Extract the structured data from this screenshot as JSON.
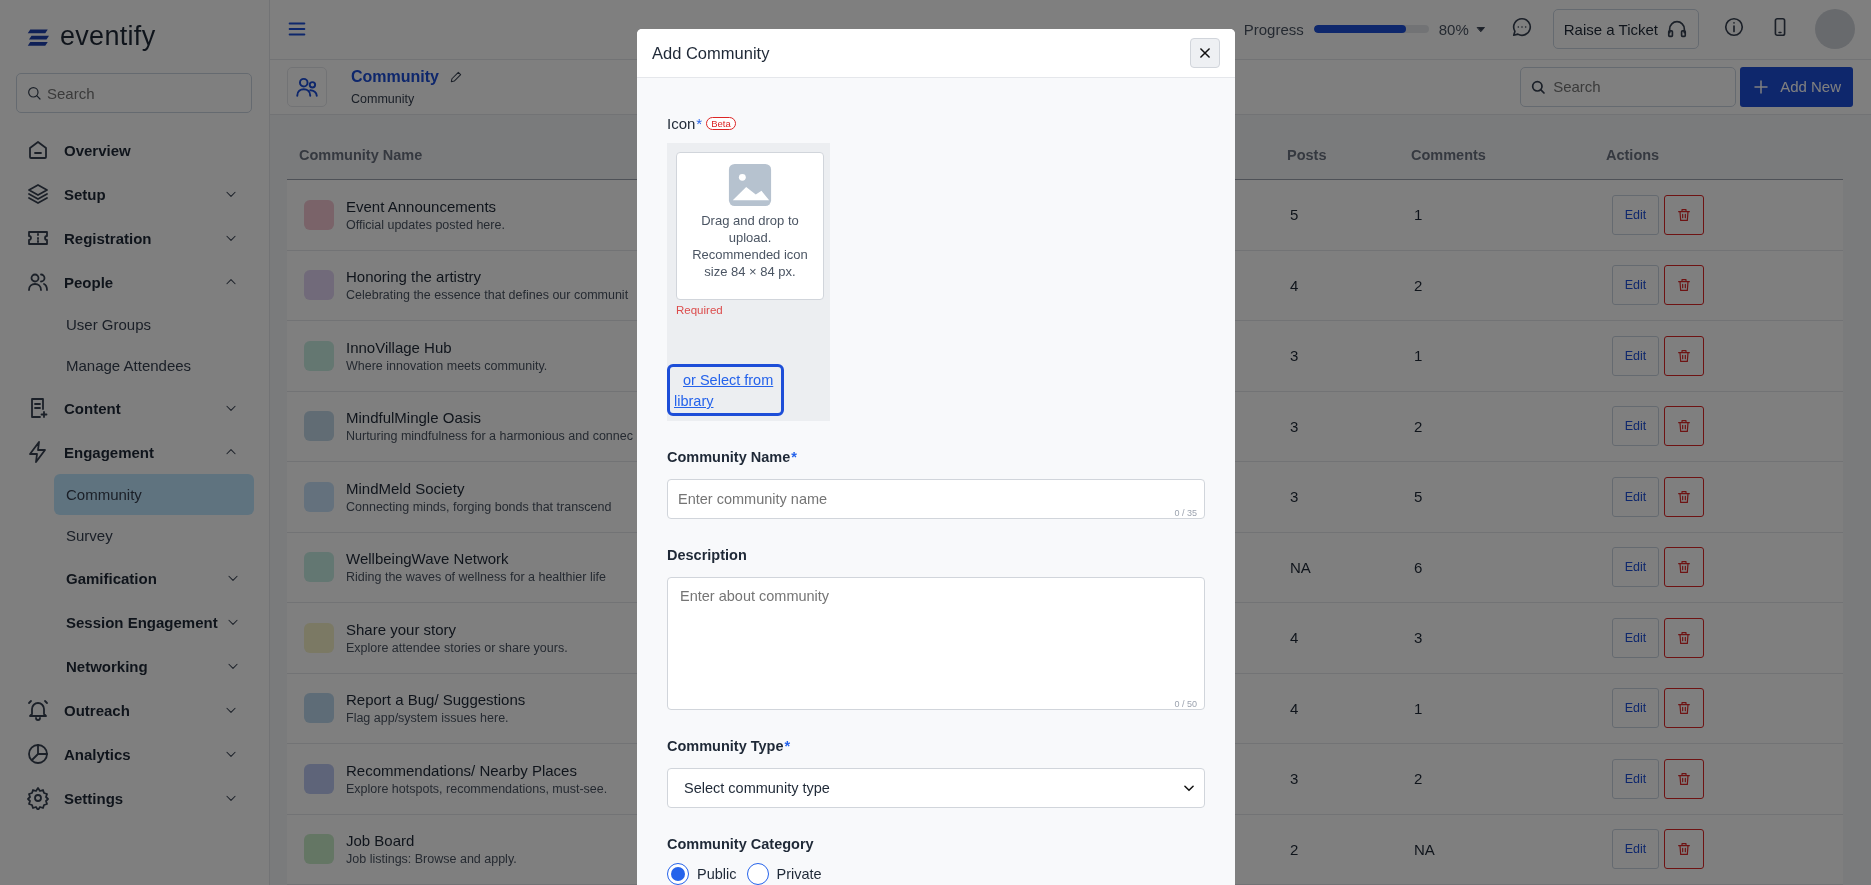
{
  "sidebar": {
    "logo": "eventify",
    "search": {
      "placeholder": "Search"
    },
    "items": [
      {
        "kind": "link",
        "label": "Overview"
      },
      {
        "kind": "group",
        "label": "Setup",
        "expanded": false
      },
      {
        "kind": "group",
        "label": "Registration",
        "expanded": false
      },
      {
        "kind": "group",
        "label": "People",
        "expanded": true,
        "children": [
          {
            "kind": "link",
            "label": "User Groups",
            "selected": false
          },
          {
            "kind": "link",
            "label": "Manage Attendees",
            "selected": false
          }
        ]
      },
      {
        "kind": "group",
        "label": "Content",
        "expanded": false
      },
      {
        "kind": "group",
        "label": "Engagement",
        "expanded": true,
        "children": [
          {
            "kind": "link",
            "label": "Community",
            "selected": true
          },
          {
            "kind": "link",
            "label": "Survey",
            "selected": false
          },
          {
            "kind": "group",
            "label": "Gamification",
            "expanded": false
          },
          {
            "kind": "group",
            "label": "Session Engagement",
            "expanded": false
          },
          {
            "kind": "group",
            "label": "Networking",
            "expanded": false
          }
        ]
      },
      {
        "kind": "group",
        "label": "Outreach",
        "expanded": false
      },
      {
        "kind": "group",
        "label": "Analytics",
        "expanded": false
      },
      {
        "kind": "group",
        "label": "Settings",
        "expanded": false
      }
    ]
  },
  "header": {
    "progress": {
      "label": "Progress",
      "level": 0.8,
      "reading": "80%"
    },
    "ticket_button": "Raise a Ticket"
  },
  "page_header": {
    "title": "Community",
    "subtitle": "Community",
    "search": {
      "placeholder": "Search"
    },
    "add_button": "Add New"
  },
  "table": {
    "columns": [
      "Community Name",
      "Posts",
      "Comments",
      "Actions"
    ],
    "rows": [
      {
        "name": "Event Announcements",
        "description": "Official updates posted here.",
        "color": "#7a6369",
        "posts": "5",
        "comments": "1",
        "edit": "Edit"
      },
      {
        "name": "Honoring the artistry",
        "description": "Celebrating the essence that defines our communit",
        "color": "#716a7a",
        "posts": "4",
        "comments": "2",
        "edit": "Edit"
      },
      {
        "name": "InnoVillage Hub",
        "description": "Where innovation meets community.",
        "color": "#647771",
        "posts": "3",
        "comments": "1",
        "edit": "Edit"
      },
      {
        "name": "MindfulMingle Oasis",
        "description": "Nurturing mindfulness for a harmonious and connec",
        "color": "#616c74",
        "posts": "3",
        "comments": "2",
        "edit": "Edit"
      },
      {
        "name": "MindMeld Society",
        "description": "Connecting minds, forging bonds that transcend",
        "color": "#64717d",
        "posts": "3",
        "comments": "5",
        "edit": "Edit"
      },
      {
        "name": "WellbeingWave Network",
        "description": "Riding the waves of wellness for a healthier life",
        "color": "#637772",
        "posts": "NA",
        "comments": "6",
        "edit": "Edit"
      },
      {
        "name": "Share your story",
        "description": "Explore attendee stories or share yours.",
        "color": "#7b7964",
        "posts": "4",
        "comments": "3",
        "edit": "Edit"
      },
      {
        "name": "Report a Bug/ Suggestions",
        "description": "Flag app/system issues here.",
        "color": "#5e6c77",
        "posts": "4",
        "comments": "1",
        "edit": "Edit"
      },
      {
        "name": "Recommendations/ Nearby Places",
        "description": "Explore hotspots, recommendations, must-see.",
        "color": "#5e6479",
        "posts": "3",
        "comments": "2",
        "edit": "Edit"
      },
      {
        "name": "Job Board",
        "description": "Job listings: Browse and apply.",
        "color": "#647664",
        "posts": "2",
        "comments": "NA",
        "edit": "Edit"
      }
    ]
  },
  "modal": {
    "title": "Add Community",
    "icon_field": {
      "label": "Icon",
      "required_mark": "*",
      "badge": "Beta",
      "upload_hint": "Drag and drop to upload. Recommended icon size 84 × 84 px.",
      "error": "Required",
      "library_link": "or Select from library"
    },
    "fields": [
      {
        "kind": "text",
        "label": "Community Name",
        "required_mark": "*",
        "placeholder": "Enter community name",
        "counter": "0 / 35"
      },
      {
        "kind": "textarea",
        "label": "Description",
        "placeholder": "Enter about community",
        "counter": "0 / 50"
      },
      {
        "kind": "select",
        "label": "Community Type",
        "required_mark": "*",
        "value": "Select community type"
      },
      {
        "kind": "radio",
        "label": "Community Category",
        "options": [
          {
            "label": "Public",
            "selected": true
          },
          {
            "label": "Private",
            "selected": false
          }
        ]
      }
    ]
  }
}
